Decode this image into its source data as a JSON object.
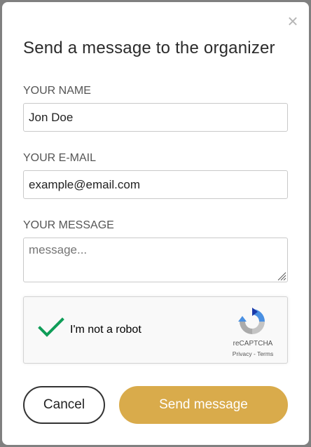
{
  "dialog": {
    "close_symbol": "×",
    "title": "Send a message to the organizer"
  },
  "form": {
    "name_label": "YOUR NAME",
    "name_value": "Jon Doe",
    "email_label": "YOUR E-MAIL",
    "email_value": "example@email.com",
    "message_label": "YOUR MESSAGE",
    "message_placeholder": "message..."
  },
  "recaptcha": {
    "checked": true,
    "label": "I'm not a robot",
    "brand": "reCAPTCHA",
    "privacy": "Privacy",
    "separator": " - ",
    "terms": "Terms",
    "icons": [
      "check-mark-icon",
      "recaptcha-logo-icon"
    ]
  },
  "buttons": {
    "cancel_label": "Cancel",
    "send_label": "Send message"
  },
  "colors": {
    "accent": "#d9ab4b",
    "check": "#0f9d58",
    "overlay": "#808080"
  }
}
